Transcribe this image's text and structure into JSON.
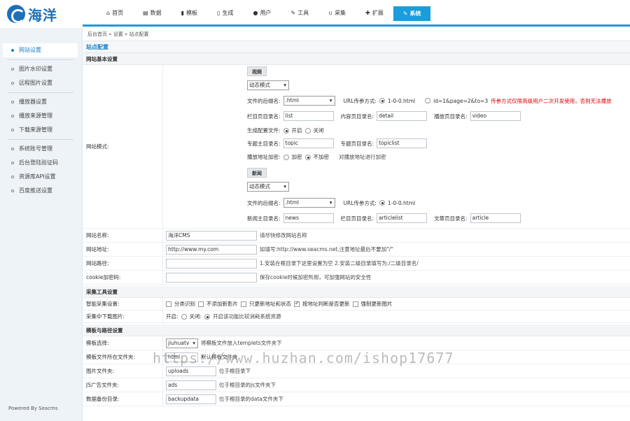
{
  "logo": {
    "text": "海洋"
  },
  "nav": [
    {
      "label": "首页",
      "icon": "home-icon",
      "glyph": "⌂"
    },
    {
      "label": "数据",
      "icon": "book-icon",
      "glyph": "▤"
    },
    {
      "label": "模板",
      "icon": "file-icon",
      "glyph": "▮"
    },
    {
      "label": "生成",
      "icon": "document-icon",
      "glyph": "▯"
    },
    {
      "label": "用户",
      "icon": "user-icon",
      "glyph": "●"
    },
    {
      "label": "工具",
      "icon": "wrench-icon",
      "glyph": "✎"
    },
    {
      "label": "采集",
      "icon": "magnet-icon",
      "glyph": "∪"
    },
    {
      "label": "扩展",
      "icon": "puzzle-icon",
      "glyph": "✚"
    },
    {
      "label": "系统",
      "icon": "edit-icon",
      "glyph": "✎"
    }
  ],
  "sidebar": {
    "items": [
      {
        "label": "网站设置"
      },
      {
        "label": "图片水印设置"
      },
      {
        "label": "远程图片设置"
      },
      {
        "label": "播放器设置"
      },
      {
        "label": "播放来源管理"
      },
      {
        "label": "下载来源管理"
      },
      {
        "label": "系统账号管理"
      },
      {
        "label": "后台登陆验证码"
      },
      {
        "label": "资源库API设置"
      },
      {
        "label": "百度推送设置"
      }
    ],
    "powered": "Powered By Seacms"
  },
  "breadcrumb": "后台首页 » 设置 » 站点配置",
  "section_title": "站点配置",
  "basic": {
    "group": "网站基本设置",
    "mode_label": "网站模式:",
    "video": {
      "badge": "视频",
      "mode": "动态模式",
      "suffix_label": "文件的后缀名:",
      "suffix": ".html",
      "url_label": "URL传参方式:",
      "url_opt1": "1-0-0.html",
      "url_opt2": "id=1&page=2&to=3",
      "url_warn": "传参方式仅限高级用户二次开发使用，否则无法播放",
      "list_dir_label": "栏目页目录名:",
      "list_dir": "list",
      "detail_dir_label": "内容页目录名:",
      "detail_dir": "detail",
      "play_dir_label": "播放页目录名:",
      "play_dir": "video",
      "gen_label": "生成配置文件:",
      "gen_on": "开启",
      "gen_off": "关闭",
      "topic_main_label": "专题主目录名:",
      "topic_main": "topic",
      "topic_page_label": "专题页目录名:",
      "topic_page": "topiclist",
      "encrypt_label": "播放地址加密:",
      "encrypt_on": "加密",
      "encrypt_off": "不加密",
      "encrypt_hint": "对播放地址进行加密"
    },
    "news": {
      "badge": "新闻",
      "mode": "动态模式",
      "suffix_label": "文件的后缀名:",
      "suffix": ".html",
      "url_label": "URL传参方式:",
      "url_opt1": "1-0-0.html",
      "main_dir_label": "新闻主目录名:",
      "main_dir": "news",
      "list_dir_label": "栏目页目录名:",
      "list_dir": "articlelist",
      "article_dir_label": "文章页目录名:",
      "article_dir": "article"
    },
    "site_name_label": "网站名称:",
    "site_name": "海洋CMS",
    "site_name_hint": "请尽快修改网站名称",
    "site_url_label": "网站地址:",
    "site_url": "http://www.my.com",
    "site_url_hint": "如填写:http://www.seacms.net,注意地址最后不要加\"/\"",
    "site_path_label": "网站路径:",
    "site_path": "",
    "site_path_hint": "1.安装在根目录下这里设置为空 2.安装二级目录填写为:/二级目录名/",
    "cookie_label": "cookie加密码:",
    "cookie": "",
    "cookie_hint": "保存cookie时候加密所用，可加强网站的安全性"
  },
  "collect": {
    "group": "采集工具设置",
    "smart_label": "智能采集设置:",
    "opt1": "分类识别",
    "opt2": "不添加新影片",
    "opt3": "只更新地址和状态",
    "opt4": "按地址判断是否更新",
    "opt5": "强制更新图片",
    "down_label": "采集中下载图片:",
    "down_on": "开启:",
    "down_off": "关闭:",
    "down_hint": "开启该功能比较消耗系统资源"
  },
  "tpl": {
    "group": "模板与路径设置",
    "choose_label": "模板选择:",
    "choose": "jiuhuatv",
    "choose_hint": "将模板文件放入templets文件夹下",
    "folder_label": "模板文件所在文件夹:",
    "folder": "html",
    "folder_hint": "默认模板文件夹",
    "pic_label": "图片文件夹:",
    "pic": "uploads",
    "pic_hint": "位于根目录下",
    "js_label": "JS广告文件夹:",
    "js": "ads",
    "js_hint": "位于根目录的js文件夹下",
    "backup_label": "数据备份目录:",
    "backup": "backupdata",
    "backup_hint": "位于根目录的data文件夹下"
  },
  "watermark": "https://www.huzhan.com/ishop17677"
}
